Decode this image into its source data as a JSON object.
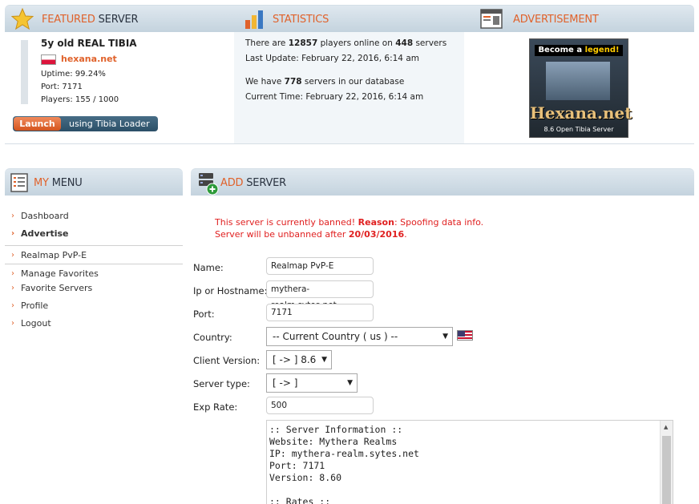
{
  "featured": {
    "title_a": "FEATURED",
    "title_b": " SERVER",
    "server_name": "5y old REAL TIBIA",
    "site": "hexana.net",
    "uptime": "Uptime: 99.24%",
    "port": "Port: 7171",
    "players": "Players: 155 / 1000",
    "launch_label": "Launch",
    "launch_text": "using Tibia Loader"
  },
  "statistics": {
    "title": "STATISTICS",
    "l1_a": "There are ",
    "players_online": "12857",
    "l1_b": " players online on ",
    "servers_online": "448",
    "l1_c": " servers",
    "last_update": "Last Update: February 22, 2016, 6:14 am",
    "l3_a": "We have ",
    "servers_db": "778",
    "l3_b": " servers in our database",
    "current_time": "Current Time: February 22, 2016, 6:14 am"
  },
  "advertisement": {
    "title": "ADVERTISEMENT",
    "banner_top_a": "Become a ",
    "banner_top_b": "legend!",
    "banner_logo": "Hexana.net",
    "banner_sub": "8.6 Open Tibia Server"
  },
  "menu": {
    "title_a": "MY",
    "title_b": " MENU",
    "items": [
      {
        "label": "Dashboard"
      },
      {
        "label": "Advertise"
      },
      {
        "label": "Realmap PvP-E"
      },
      {
        "label": "Manage Favorites"
      },
      {
        "label": "Favorite Servers"
      },
      {
        "label": "Profile"
      },
      {
        "label": "Logout"
      }
    ]
  },
  "add_server": {
    "title_a": "ADD",
    "title_b": " SERVER",
    "ban_a": "This server is currently banned! ",
    "ban_reason_label": "Reason",
    "ban_reason": ": Spoofing data info.",
    "unban_a": "Server will be unbanned after ",
    "unban_date": "20/03/2016",
    "unban_b": ".",
    "fields": {
      "name_label": "Name:",
      "name_value": "Realmap PvP-E",
      "host_label": "Ip or Hostname:",
      "host_value": "mythera-realm.sytes.net",
      "port_label": "Port:",
      "port_value": "7171",
      "country_label": "Country:",
      "country_value": "-- Current Country ( us ) --",
      "client_label": "Client Version:",
      "client_value": "[ -> ] 8.6",
      "type_label": "Server type:",
      "type_value": "[ -> ]",
      "exp_label": "Exp Rate:",
      "exp_value": "500"
    },
    "description_lines": [
      ":: Server Information ::",
      "Website: Mythera Realms",
      "IP: mythera-realm.sytes.net",
      "Port: 7171",
      "Version: 8.60",
      "",
      ":: Rates ::"
    ]
  }
}
